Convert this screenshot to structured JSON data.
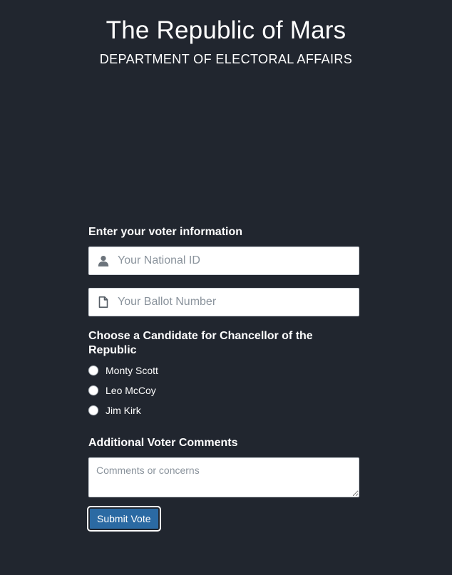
{
  "header": {
    "title": "The Republic of Mars",
    "subtitle": "DEPARTMENT OF ELECTORAL AFFAIRS"
  },
  "voter_info": {
    "label": "Enter your voter information",
    "national_id": {
      "placeholder": "Your National ID",
      "value": "",
      "icon": "user-icon"
    },
    "ballot_number": {
      "placeholder": "Your Ballot Number",
      "value": "",
      "icon": "document-icon"
    }
  },
  "candidates": {
    "label": "Choose a Candidate for Chancellor of the Republic",
    "options": [
      "Monty Scott",
      "Leo McCoy",
      "Jim Kirk"
    ],
    "selected": null
  },
  "comments": {
    "label": "Additional Voter Comments",
    "placeholder": "Comments or concerns",
    "value": ""
  },
  "submit": {
    "label": "Submit Vote"
  },
  "colors": {
    "background": "#21262f",
    "button": "#2b6aa3",
    "text": "#ffffff"
  }
}
